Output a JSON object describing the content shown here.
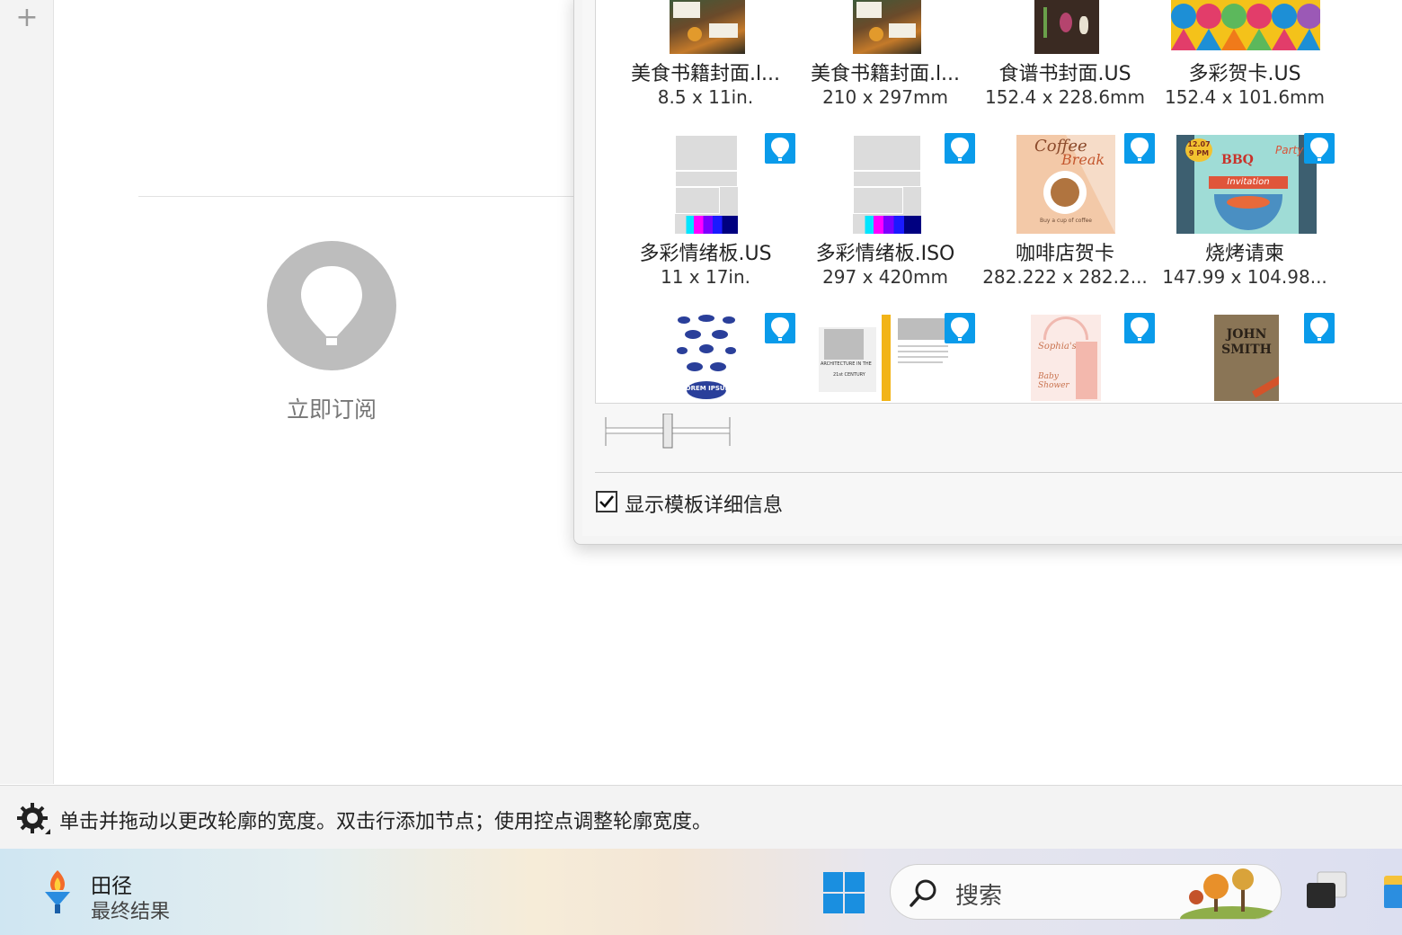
{
  "left_toolbar": {
    "add_symbol": "+"
  },
  "subscribe": {
    "label": "立即订阅"
  },
  "templates": [
    {
      "name": "美食书籍封面.l...",
      "size": "8.5 x 11in.",
      "premium": false
    },
    {
      "name": "美食书籍封面.l...",
      "size": "210 x 297mm",
      "premium": false
    },
    {
      "name": "食谱书封面.US",
      "size": "152.4 x 228.6mm",
      "premium": false
    },
    {
      "name": "多彩贺卡.US",
      "size": "152.4 x 101.6mm",
      "premium": false
    },
    {
      "name": "多彩情绪板.US",
      "size": "11 x 17in.",
      "premium": true
    },
    {
      "name": "多彩情绪板.ISO",
      "size": "297 x 420mm",
      "premium": true
    },
    {
      "name": "咖啡店贺卡",
      "size": "282.222 x 282.2...",
      "premium": true
    },
    {
      "name": "烧烤请柬",
      "size": "147.99 x 104.98...",
      "premium": true
    },
    {
      "name": "",
      "size": "",
      "premium": true
    },
    {
      "name": "",
      "size": "",
      "premium": true
    },
    {
      "name": "",
      "size": "",
      "premium": true
    },
    {
      "name": "",
      "size": "",
      "premium": true
    }
  ],
  "thumb_text": {
    "coffee_title": "Coffee",
    "coffee_sub": "Break",
    "coffee_tag": "Buy a cup of coffee",
    "bbq_date": "12.07",
    "bbq_time": "9 PM",
    "bbq_title": "BBQ",
    "bbq_party": "Party",
    "bbq_invite": "Invitation",
    "pattern_label": "LOREM IPSUM",
    "arch_title": "ARCHITECTURE IN THE",
    "arch_century": "21st CENTURY",
    "baby_name": "Sophia's",
    "baby_shower": "Baby Shower",
    "book_author_first": "JOHN",
    "book_author_last": "SMITH"
  },
  "show_details": {
    "label": "显示模板详细信息",
    "checked": true
  },
  "status": {
    "message": "单击并拖动以更改轮廓的宽度。双击行添加节点；使用控点调整轮廓宽度。"
  },
  "taskbar": {
    "app_title": "田径",
    "app_subtitle": "最终结果",
    "search_placeholder": "搜索"
  },
  "colors": {
    "badge": "#0a9bea",
    "subscribe_circle": "#bdbdbd",
    "status_bg": "#f3f3f3"
  }
}
